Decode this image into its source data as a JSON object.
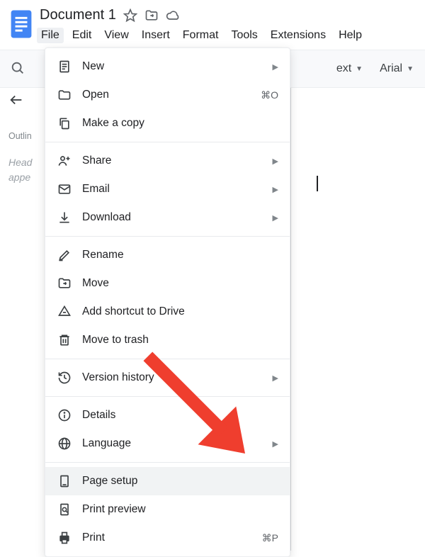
{
  "header": {
    "doc_title": "Document 1"
  },
  "menubar": {
    "file": "File",
    "edit": "Edit",
    "view": "View",
    "insert": "Insert",
    "format": "Format",
    "tools": "Tools",
    "extensions": "Extensions",
    "help": "Help"
  },
  "toolbar": {
    "style_label_fragment": "ext",
    "font_label": "Arial"
  },
  "sidepane": {
    "outline_label": "Outlin",
    "placeholder_line1": "Head",
    "placeholder_line2": "appe"
  },
  "file_menu": {
    "new": "New",
    "open": "Open",
    "open_shortcut": "⌘O",
    "make_copy": "Make a copy",
    "share": "Share",
    "email": "Email",
    "download": "Download",
    "rename": "Rename",
    "move": "Move",
    "add_shortcut": "Add shortcut to Drive",
    "move_trash": "Move to trash",
    "version_history": "Version history",
    "details": "Details",
    "language": "Language",
    "page_setup": "Page setup",
    "print_preview": "Print preview",
    "print": "Print",
    "print_shortcut": "⌘P"
  }
}
